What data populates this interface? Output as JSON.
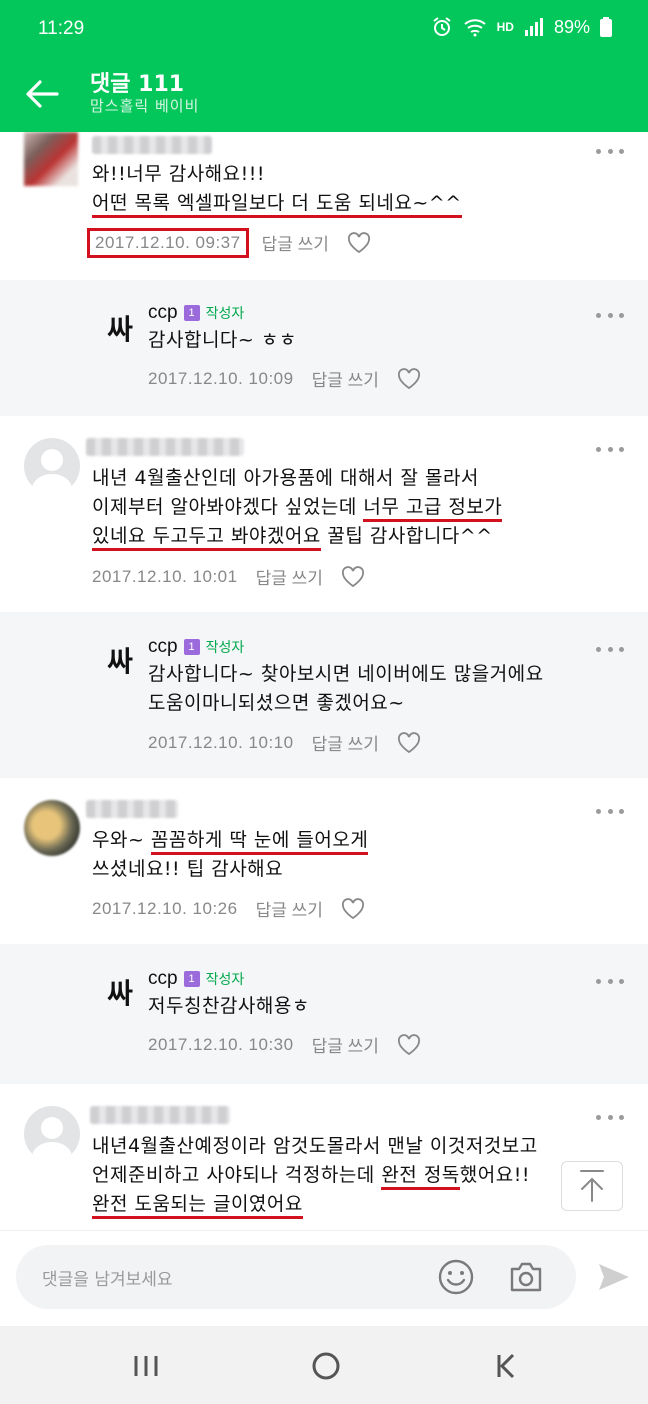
{
  "status_bar": {
    "time": "11:29",
    "network": "HD",
    "battery": "89%"
  },
  "header": {
    "title": "댓글 111",
    "subtitle": "맘스홀릭 베이비"
  },
  "comments": [
    {
      "type": "comment",
      "lines": [
        "와!!너무 감사해요!!!",
        "어떤 목록 엑셀파일보다 더 도움 되네요~^^"
      ],
      "date": "2017.12.10. 09:37",
      "reply_label": "답글 쓰기"
    },
    {
      "type": "reply",
      "nickname": "ccp",
      "level": "1",
      "author_badge": "작성자",
      "avatar_text": "싸",
      "lines": [
        "감사합니다~ ㅎㅎ"
      ],
      "date": "2017.12.10. 10:09",
      "reply_label": "답글 쓰기"
    },
    {
      "type": "comment",
      "lines": [
        "내년 4월출산인데 아가용품에 대해서 잘 몰라서",
        "이제부터 알아봐야겠다 싶었는데 너무 고급 정보가",
        "있네요 두고두고 봐야겠어요 꿀팁 감사합니다^^"
      ],
      "date": "2017.12.10. 10:01",
      "reply_label": "답글 쓰기"
    },
    {
      "type": "reply",
      "nickname": "ccp",
      "level": "1",
      "author_badge": "작성자",
      "avatar_text": "싸",
      "lines": [
        "감사합니다~ 찾아보시면 네이버에도 많을거에요",
        "도움이마니되셨으면 좋겠어요~"
      ],
      "date": "2017.12.10. 10:10",
      "reply_label": "답글 쓰기"
    },
    {
      "type": "comment",
      "lines": [
        "우와~ 꼼꼼하게 딱 눈에 들어오게",
        "쓰셨네요!! 팁 감사해요"
      ],
      "date": "2017.12.10. 10:26",
      "reply_label": "답글 쓰기"
    },
    {
      "type": "reply",
      "nickname": "ccp",
      "level": "1",
      "author_badge": "작성자",
      "avatar_text": "싸",
      "lines": [
        "저두칭찬감사해용ㅎ"
      ],
      "date": "2017.12.10. 10:30",
      "reply_label": "답글 쓰기"
    },
    {
      "type": "comment",
      "lines": [
        "내년4월출산예정이라 암것도몰라서 맨날 이것저것보고",
        "언제준비하고 사야되나 걱정하는데 완전 정독했어요!!",
        "완전 도움되는 글이였어요"
      ]
    }
  ],
  "input": {
    "placeholder": "댓글을 남겨보세요"
  }
}
